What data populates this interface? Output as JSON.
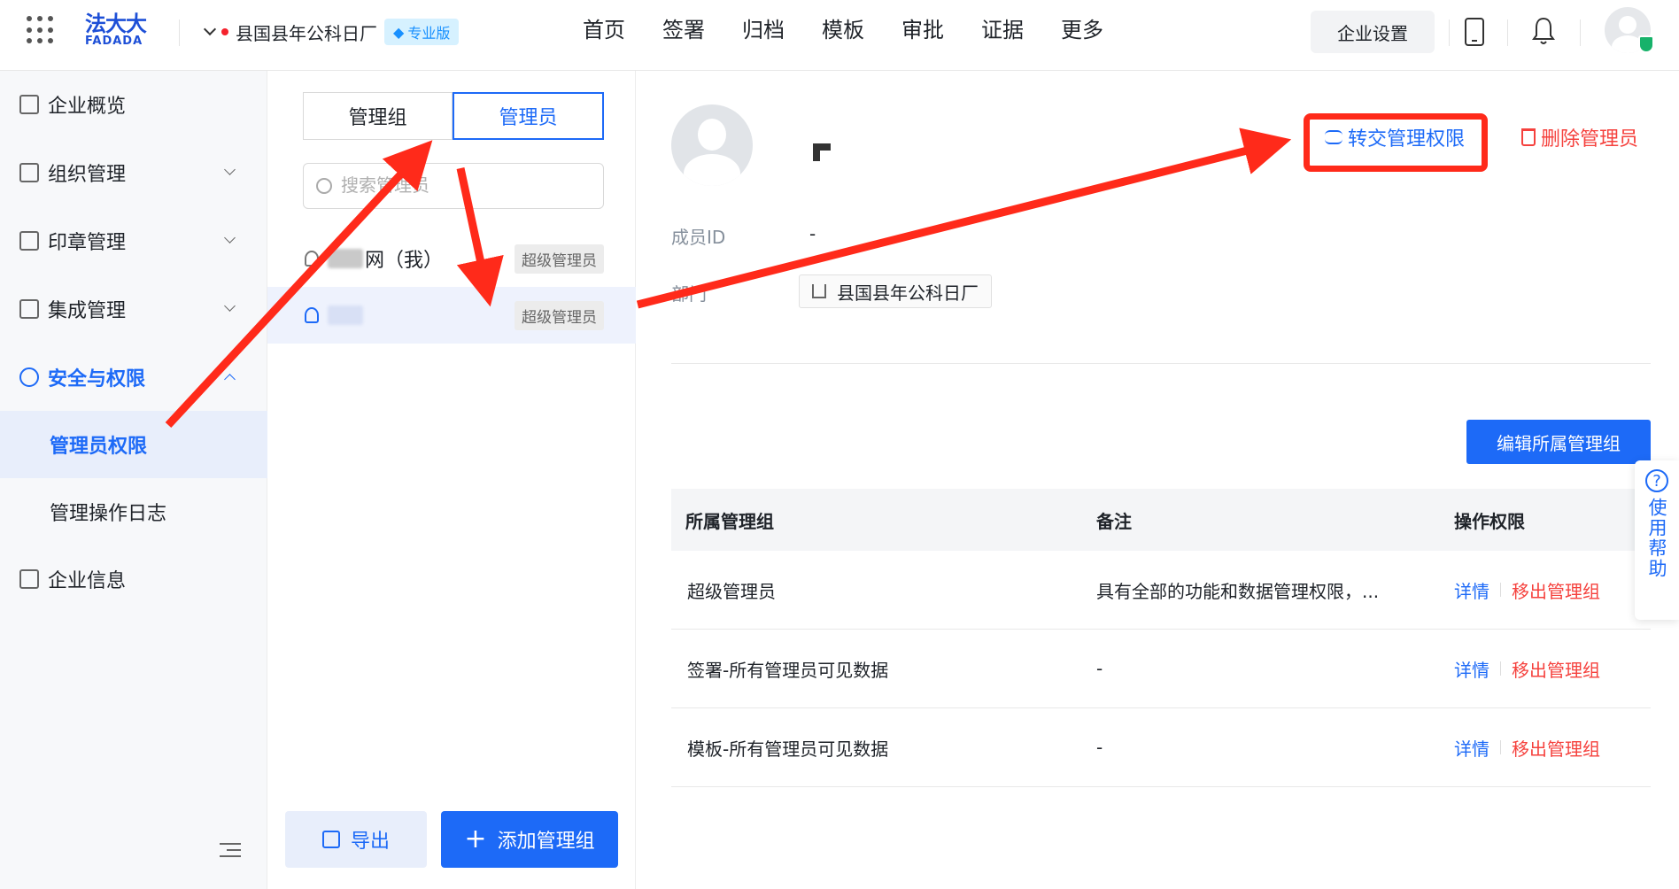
{
  "header": {
    "logo_cn": "法大大",
    "logo_en": "FADADA",
    "company": "县国县年公科日厂",
    "edition": "专业版",
    "nav": [
      "首页",
      "签署",
      "归档",
      "模板",
      "审批",
      "证据",
      "更多"
    ],
    "enterprise_settings": "企业设置"
  },
  "sidebar": {
    "items": [
      {
        "label": "企业概览"
      },
      {
        "label": "组织管理"
      },
      {
        "label": "印章管理"
      },
      {
        "label": "集成管理"
      },
      {
        "label": "安全与权限"
      },
      {
        "label": "管理员权限"
      },
      {
        "label": "管理操作日志"
      },
      {
        "label": "企业信息"
      }
    ]
  },
  "middle": {
    "tabs": [
      "管理组",
      "管理员"
    ],
    "search_placeholder": "搜索管理员",
    "members": [
      {
        "name_suffix": "网（我）",
        "tag": "超级管理员"
      },
      {
        "name_suffix": "",
        "tag": "超级管理员"
      }
    ],
    "export_label": "导出",
    "add_group_label": "添加管理组"
  },
  "detail": {
    "transfer_label": "转交管理权限",
    "delete_label": "删除管理员",
    "member_id_label": "成员ID",
    "member_id_value": "-",
    "dept_label": "部门",
    "dept_value": "县国县年公科日厂",
    "edit_group_label": "编辑所属管理组",
    "table": {
      "headers": [
        "所属管理组",
        "备注",
        "操作权限"
      ],
      "rows": [
        {
          "group": "超级管理员",
          "note": "具有全部的功能和数据管理权限，...",
          "detail": "详情",
          "remove": "移出管理组"
        },
        {
          "group": "签署-所有管理员可见数据",
          "note": "-",
          "detail": "详情",
          "remove": "移出管理组"
        },
        {
          "group": "模板-所有管理员可见数据",
          "note": "-",
          "detail": "详情",
          "remove": "移出管理组"
        }
      ]
    }
  },
  "help": {
    "label": "使用帮助",
    "icon": "?"
  },
  "colors": {
    "accent": "#1d6af7",
    "danger": "#f5413d",
    "annotation": "#ff2a1a"
  }
}
